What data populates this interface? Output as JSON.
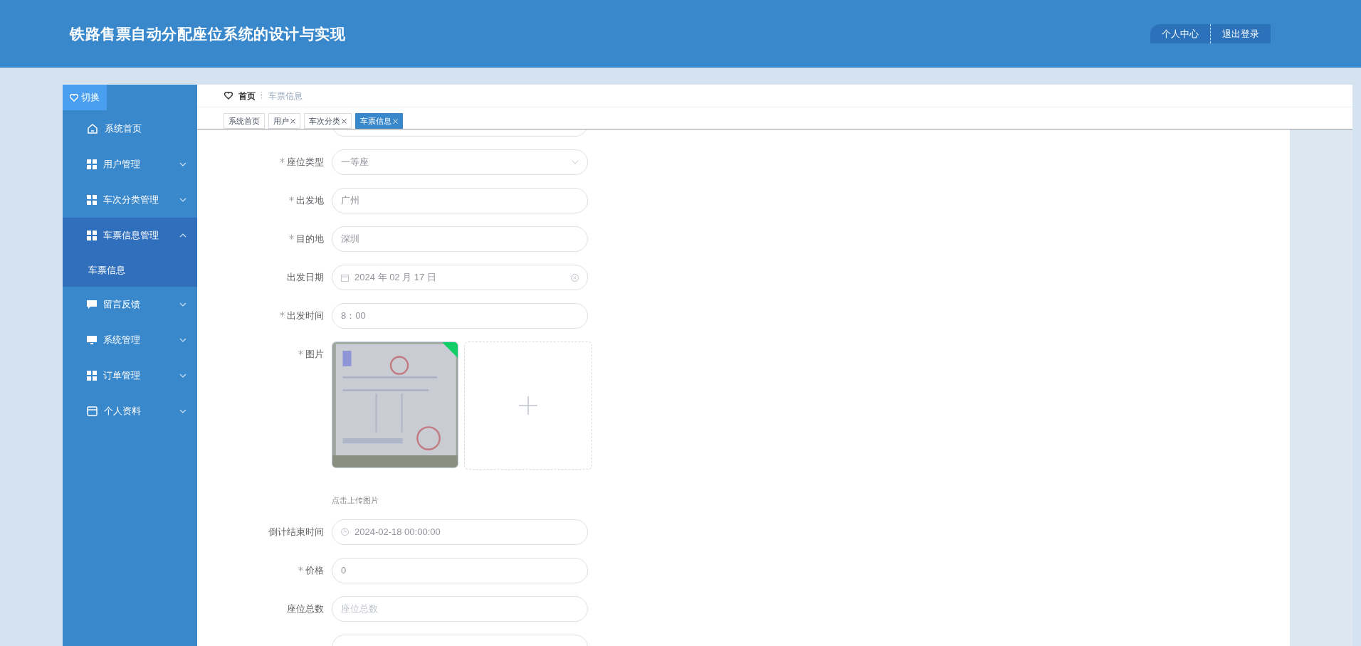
{
  "header": {
    "title": "铁路售票自动分配座位系统的设计与实现",
    "actions": [
      {
        "label": "个人中心",
        "kind": "round"
      },
      {
        "label": "退出登录",
        "kind": "square"
      }
    ]
  },
  "sidebar": {
    "toggle": "切换",
    "items": [
      {
        "label": "系统首页",
        "kind": "home",
        "expandable": false,
        "selected": false
      },
      {
        "label": "用户管理",
        "kind": "grid",
        "expandable": true,
        "expanded": false,
        "selected": false
      },
      {
        "label": "车次分类管理",
        "kind": "grid",
        "expandable": true,
        "expanded": false,
        "selected": false
      },
      {
        "label": "车票信息管理",
        "kind": "grid",
        "expandable": true,
        "expanded": true,
        "selected": true,
        "children": [
          {
            "label": "车票信息",
            "selected": true
          }
        ]
      },
      {
        "label": "留言反馈",
        "kind": "chat",
        "expandable": true,
        "expanded": false,
        "selected": false
      },
      {
        "label": "系统管理",
        "kind": "monitor",
        "expandable": true,
        "expanded": false,
        "selected": false
      },
      {
        "label": "订单管理",
        "kind": "grid",
        "expandable": true,
        "expanded": false,
        "selected": false
      },
      {
        "label": "个人资料",
        "kind": "card",
        "expandable": true,
        "expanded": false,
        "selected": false
      }
    ]
  },
  "breadcrumb": [
    {
      "label": "首页",
      "current": false
    },
    {
      "label": "车票信息",
      "current": true
    }
  ],
  "tabs": [
    {
      "label": "系统首页",
      "closable": false,
      "selected": false
    },
    {
      "label": "用户",
      "closable": true,
      "selected": false
    },
    {
      "label": "车次分类",
      "closable": true,
      "selected": false
    },
    {
      "label": "车票信息",
      "closable": true,
      "selected": true
    }
  ],
  "form": [
    {
      "kind": "input",
      "required": false
    },
    {
      "kind": "select",
      "label": "座位类型",
      "required": true,
      "value": "一等座"
    },
    {
      "kind": "input",
      "label": "出发地",
      "required": true,
      "value": "广州"
    },
    {
      "kind": "input",
      "label": "目的地",
      "required": true,
      "value": "深圳"
    },
    {
      "kind": "date",
      "label": "出发日期",
      "required": false,
      "value": "2024 年 02 月 17 日"
    },
    {
      "kind": "input",
      "label": "出发时间",
      "required": true,
      "value": "8：00"
    },
    {
      "kind": "upload",
      "label": "图片",
      "required": true,
      "hint": "点击上传图片",
      "uploaded": true
    },
    {
      "kind": "datetime",
      "label": "倒计结束时间",
      "required": false,
      "value": "2024-02-18 00:00:00"
    },
    {
      "kind": "input",
      "label": "价格",
      "required": true,
      "value": "0"
    },
    {
      "kind": "input",
      "label": "座位总数",
      "required": false,
      "placeholder": "座位总数"
    },
    {
      "kind": "input",
      "required": false
    }
  ]
}
